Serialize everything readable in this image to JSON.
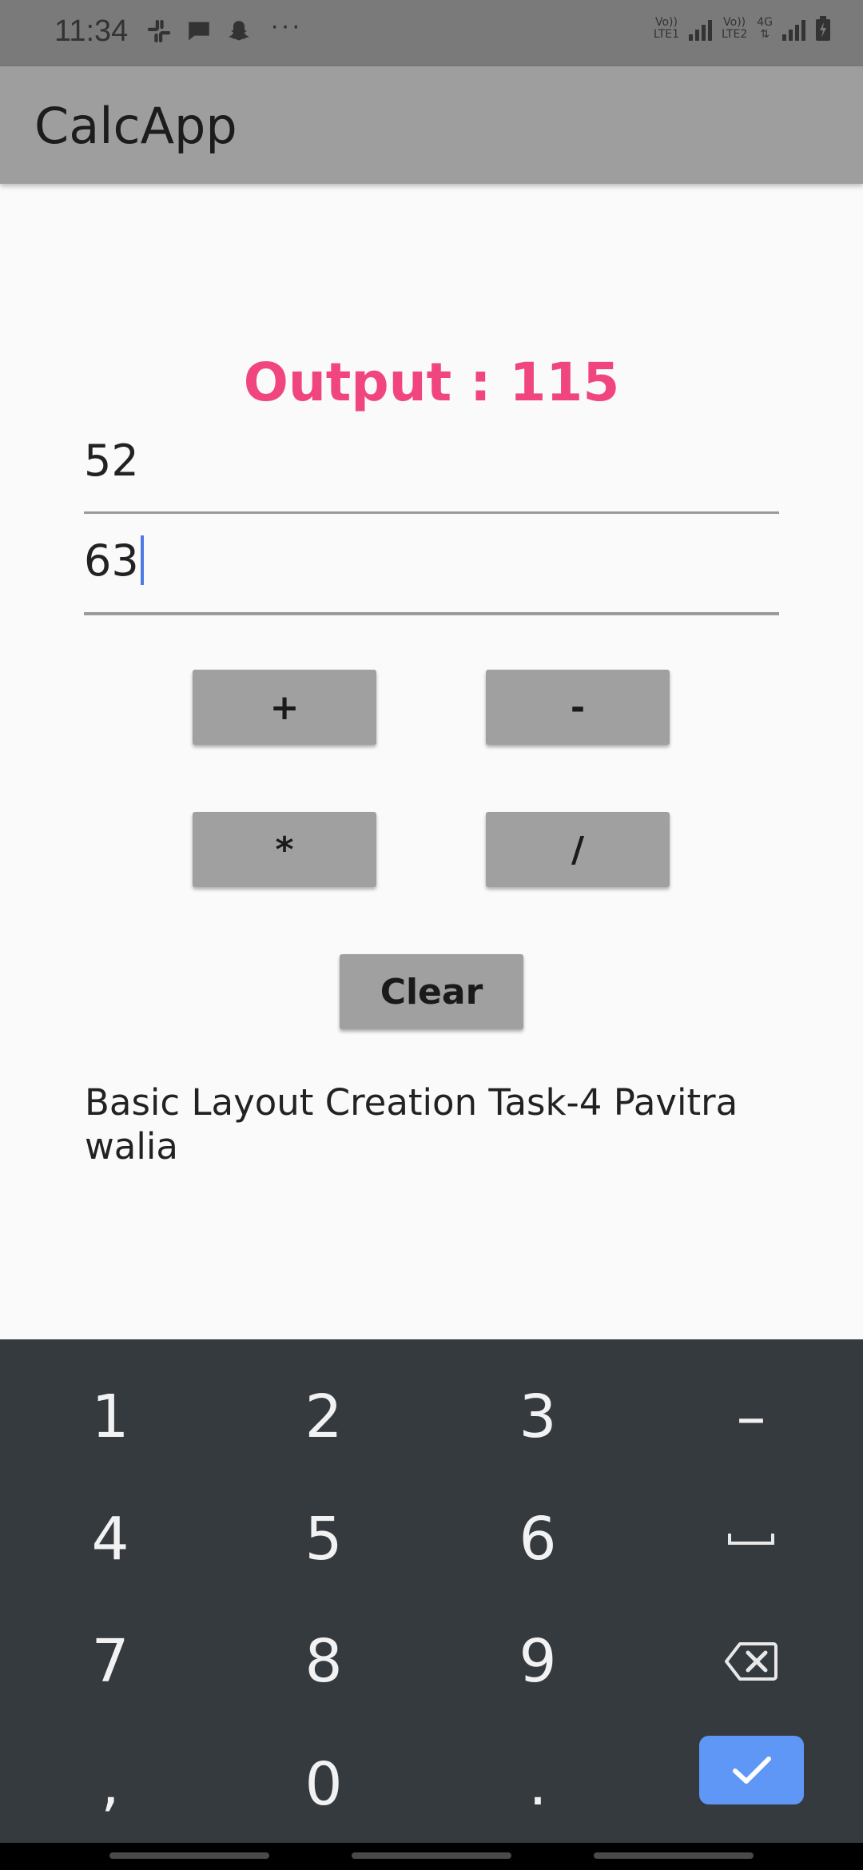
{
  "status_bar": {
    "time": "11:34",
    "icons_left": [
      "slack-icon",
      "message-icon",
      "snapchat-icon"
    ],
    "more": "···",
    "sim1_label": "Vo))\nLTE1",
    "sim2_label": "Vo))\nLTE2",
    "network": "4G"
  },
  "app_bar": {
    "title": "CalcApp"
  },
  "output": {
    "text": "Output : 115"
  },
  "inputs": {
    "first_value": "52",
    "second_value": "63"
  },
  "buttons": {
    "add": "+",
    "subtract": "-",
    "multiply": "*",
    "divide": "/",
    "clear": "Clear"
  },
  "caption": "Basic Layout Creation Task-4 Pavitra walia",
  "keyboard": {
    "keys": [
      "1",
      "2",
      "3",
      "–",
      "4",
      "5",
      "6",
      "␣",
      "7",
      "8",
      "9",
      "⌫",
      ",",
      "0",
      ".",
      "✓"
    ]
  },
  "colors": {
    "accent": "#f0457f",
    "app_bar": "#9e9e9e",
    "keyboard_bg": "#353a3f",
    "done_key": "#5e97f6"
  }
}
